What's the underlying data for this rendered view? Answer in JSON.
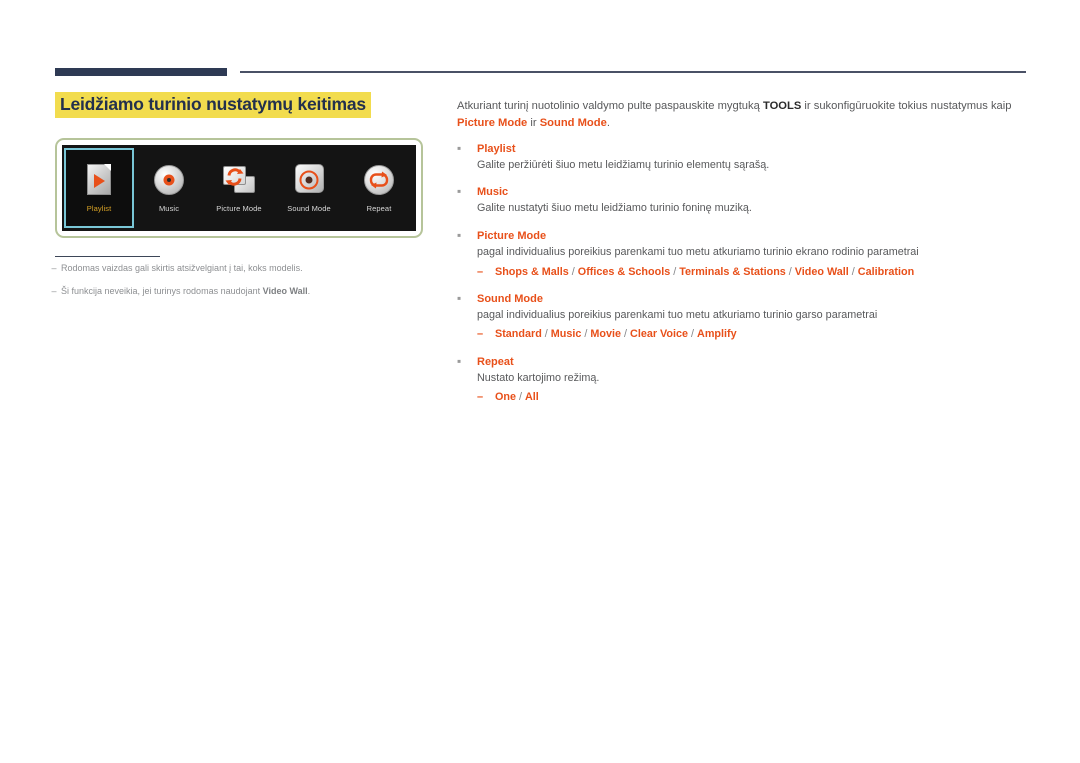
{
  "header": {
    "rule_color": "#2e3a54",
    "thin_rule_color": "#4a5166"
  },
  "page_title": "Leidžiamo turinio nustatymų keitimas",
  "title_highlight_color": "#f2dc4e",
  "accent_color": "#e8501a",
  "figure": {
    "frame_color": "#b6c49a",
    "background": "#141414",
    "selection_border": "#79c6d6",
    "items": [
      {
        "label": "Playlist",
        "icon": "playlist-document-play-icon",
        "selected": true
      },
      {
        "label": "Music",
        "icon": "music-disc-icon",
        "selected": false
      },
      {
        "label": "Picture Mode",
        "icon": "picture-mode-cards-refresh-icon",
        "selected": false
      },
      {
        "label": "Sound Mode",
        "icon": "sound-mode-ring-icon",
        "selected": false
      },
      {
        "label": "Repeat",
        "icon": "repeat-loop-icon",
        "selected": false
      }
    ]
  },
  "footnotes": [
    {
      "dash": "–",
      "text": "Rodomas vaizdas gali skirtis atsižvelgiant į tai, koks modelis."
    },
    {
      "dash": "–",
      "text_before": "Ši funkcija neveikia, jei turinys rodomas naudojant ",
      "bold": "Video Wall",
      "text_after": "."
    }
  ],
  "intro": {
    "p1": "Atkuriant turinį nuotolinio valdymo pulte paspauskite mygtuką ",
    "kb": "TOOLS",
    "p2": " ir sukonfigūruokite tokius nustatymus kaip ",
    "hl1": "Picture Mode",
    "p3": " ir ",
    "hl2": "Sound Mode",
    "p4": "."
  },
  "bullets": [
    {
      "bullet": "▪",
      "title": "Playlist",
      "desc": "Galite peržiūrėti šiuo metu leidžiamų turinio elementų sąrašą.",
      "options": []
    },
    {
      "bullet": "▪",
      "title": "Music",
      "desc": "Galite nustatyti šiuo metu leidžiamo turinio foninę muziką.",
      "options": []
    },
    {
      "bullet": "▪",
      "title": "Picture Mode",
      "desc": "pagal individualius poreikius parenkami tuo metu atkuriamo turinio ekrano rodinio parametrai",
      "dash": "–",
      "options": [
        "Shops & Malls",
        "Offices & Schools",
        "Terminals & Stations",
        "Video Wall",
        "Calibration"
      ]
    },
    {
      "bullet": "▪",
      "title": "Sound Mode",
      "desc": "pagal individualius poreikius parenkami tuo metu atkuriamo turinio garso parametrai",
      "dash": "–",
      "options": [
        "Standard",
        "Music",
        "Movie",
        "Clear Voice",
        "Amplify"
      ]
    },
    {
      "bullet": "▪",
      "title": "Repeat",
      "desc": "Nustato kartojimo režimą.",
      "dash": "–",
      "options": [
        "One",
        "All"
      ]
    }
  ],
  "option_separator": "/"
}
